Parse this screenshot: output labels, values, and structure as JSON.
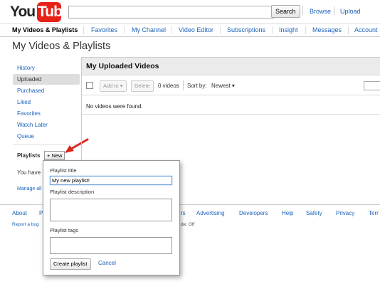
{
  "header": {
    "logo_text_you": "You",
    "logo_text_tube": "Tube",
    "search_value": "",
    "search_button": "Search",
    "browse": "Browse",
    "upload": "Upload"
  },
  "nav": {
    "items": [
      "My Videos & Playlists",
      "Favorites",
      "My Channel",
      "Video Editor",
      "Subscriptions",
      "Insight",
      "Messages",
      "Account"
    ]
  },
  "page": {
    "title": "My Videos & Playlists"
  },
  "sidebar": {
    "items": [
      "History",
      "Uploaded",
      "Purchased",
      "Liked",
      "Favorites",
      "Watch Later",
      "Queue"
    ],
    "selected": "Uploaded",
    "playlists_label": "Playlists",
    "new_button": "+ New",
    "you_have": "You have",
    "manage_all": "Manage all"
  },
  "content": {
    "title": "My Uploaded Videos",
    "add_to": "Add to",
    "delete": "Delete",
    "video_count": "0 videos",
    "sort_by": "Sort by:",
    "sort_value": "Newest",
    "empty_message": "No videos were found."
  },
  "popup": {
    "title_label": "Playlist title",
    "title_value": "My new playlist!",
    "description_label": "Playlist description",
    "description_value": "",
    "tags_label": "Playlist tags",
    "tags_value": "",
    "create_button": "Create playlist",
    "cancel": "Cancel"
  },
  "footer": {
    "links": [
      "About",
      "P",
      "rs",
      "Advertising",
      "Developers",
      "Help",
      "Safety",
      "Privacy",
      "Terr"
    ],
    "report_bug": "Report a bug",
    "mode": "de: Off"
  },
  "colors": {
    "youtube_red": "#e62117",
    "link_blue": "#1c62b9",
    "annotation_arrow": "#d9271c"
  }
}
